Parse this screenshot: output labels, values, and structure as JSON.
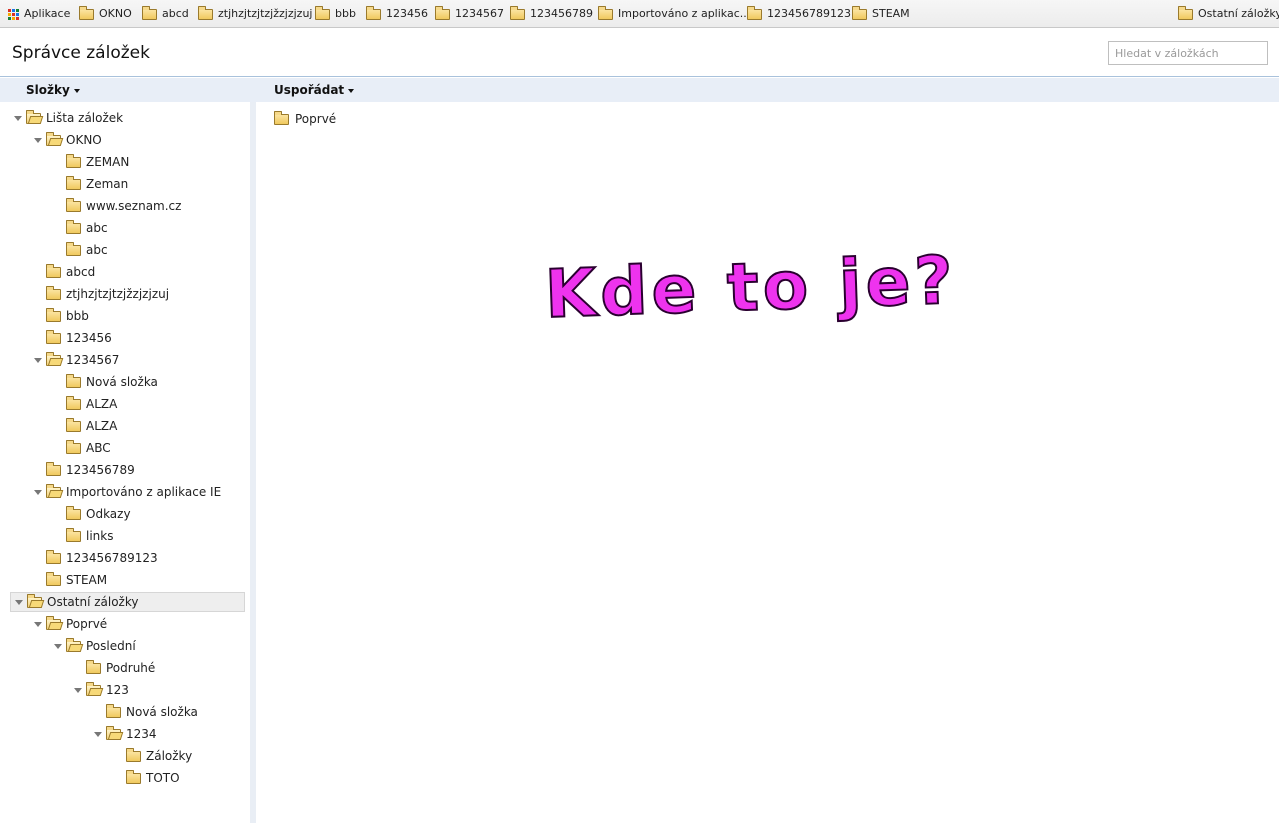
{
  "bookmarks_bar": {
    "apps_label": "Aplikace",
    "items": [
      "OKNO",
      "abcd",
      "ztjhzjtzjtzjžzjzjzuj",
      "bbb",
      "123456",
      "1234567",
      "123456789",
      "Importováno z aplikac...",
      "123456789123",
      "STEAM"
    ],
    "other_label": "Ostatní záložky",
    "apps_colors": [
      "#d93025",
      "#1a73e8",
      "#188038",
      "#f9ab00",
      "#d93025",
      "#1a73e8",
      "#188038",
      "#f9ab00",
      "#d93025"
    ]
  },
  "header": {
    "title": "Správce záložek",
    "search_placeholder": "Hledat v záložkách"
  },
  "toolbar": {
    "folders_menu": "Složky",
    "organize_menu": "Uspořádat"
  },
  "tree": [
    {
      "label": "Lišta záložek",
      "depth": 0,
      "open": true
    },
    {
      "label": "OKNO",
      "depth": 1,
      "open": true
    },
    {
      "label": "ZEMAN",
      "depth": 2
    },
    {
      "label": "Zeman",
      "depth": 2
    },
    {
      "label": "www.seznam.cz",
      "depth": 2
    },
    {
      "label": "abc",
      "depth": 2
    },
    {
      "label": "abc",
      "depth": 2
    },
    {
      "label": "abcd",
      "depth": 1
    },
    {
      "label": "ztjhzjtzjtzjžzjzjzuj",
      "depth": 1
    },
    {
      "label": "bbb",
      "depth": 1
    },
    {
      "label": "123456",
      "depth": 1
    },
    {
      "label": "1234567",
      "depth": 1,
      "open": true
    },
    {
      "label": "Nová složka",
      "depth": 2
    },
    {
      "label": "ALZA",
      "depth": 2
    },
    {
      "label": "ALZA",
      "depth": 2
    },
    {
      "label": "ABC",
      "depth": 2
    },
    {
      "label": "123456789",
      "depth": 1
    },
    {
      "label": "Importováno z aplikace IE",
      "depth": 1,
      "open": true
    },
    {
      "label": "Odkazy",
      "depth": 2
    },
    {
      "label": "links",
      "depth": 2
    },
    {
      "label": "123456789123",
      "depth": 1
    },
    {
      "label": "STEAM",
      "depth": 1
    },
    {
      "label": "Ostatní záložky",
      "depth": 0,
      "open": true,
      "selected": true
    },
    {
      "label": "Poprvé",
      "depth": 1,
      "open": true
    },
    {
      "label": "Poslední",
      "depth": 2,
      "open": true
    },
    {
      "label": "Podruhé",
      "depth": 3
    },
    {
      "label": "123",
      "depth": 3,
      "open": true
    },
    {
      "label": "Nová složka",
      "depth": 4
    },
    {
      "label": "1234",
      "depth": 4,
      "open": true
    },
    {
      "label": "Záložky",
      "depth": 5
    },
    {
      "label": "TOTO",
      "depth": 5
    }
  ],
  "list": {
    "items": [
      "Poprvé"
    ]
  },
  "overlay_text": "Kde to je?"
}
